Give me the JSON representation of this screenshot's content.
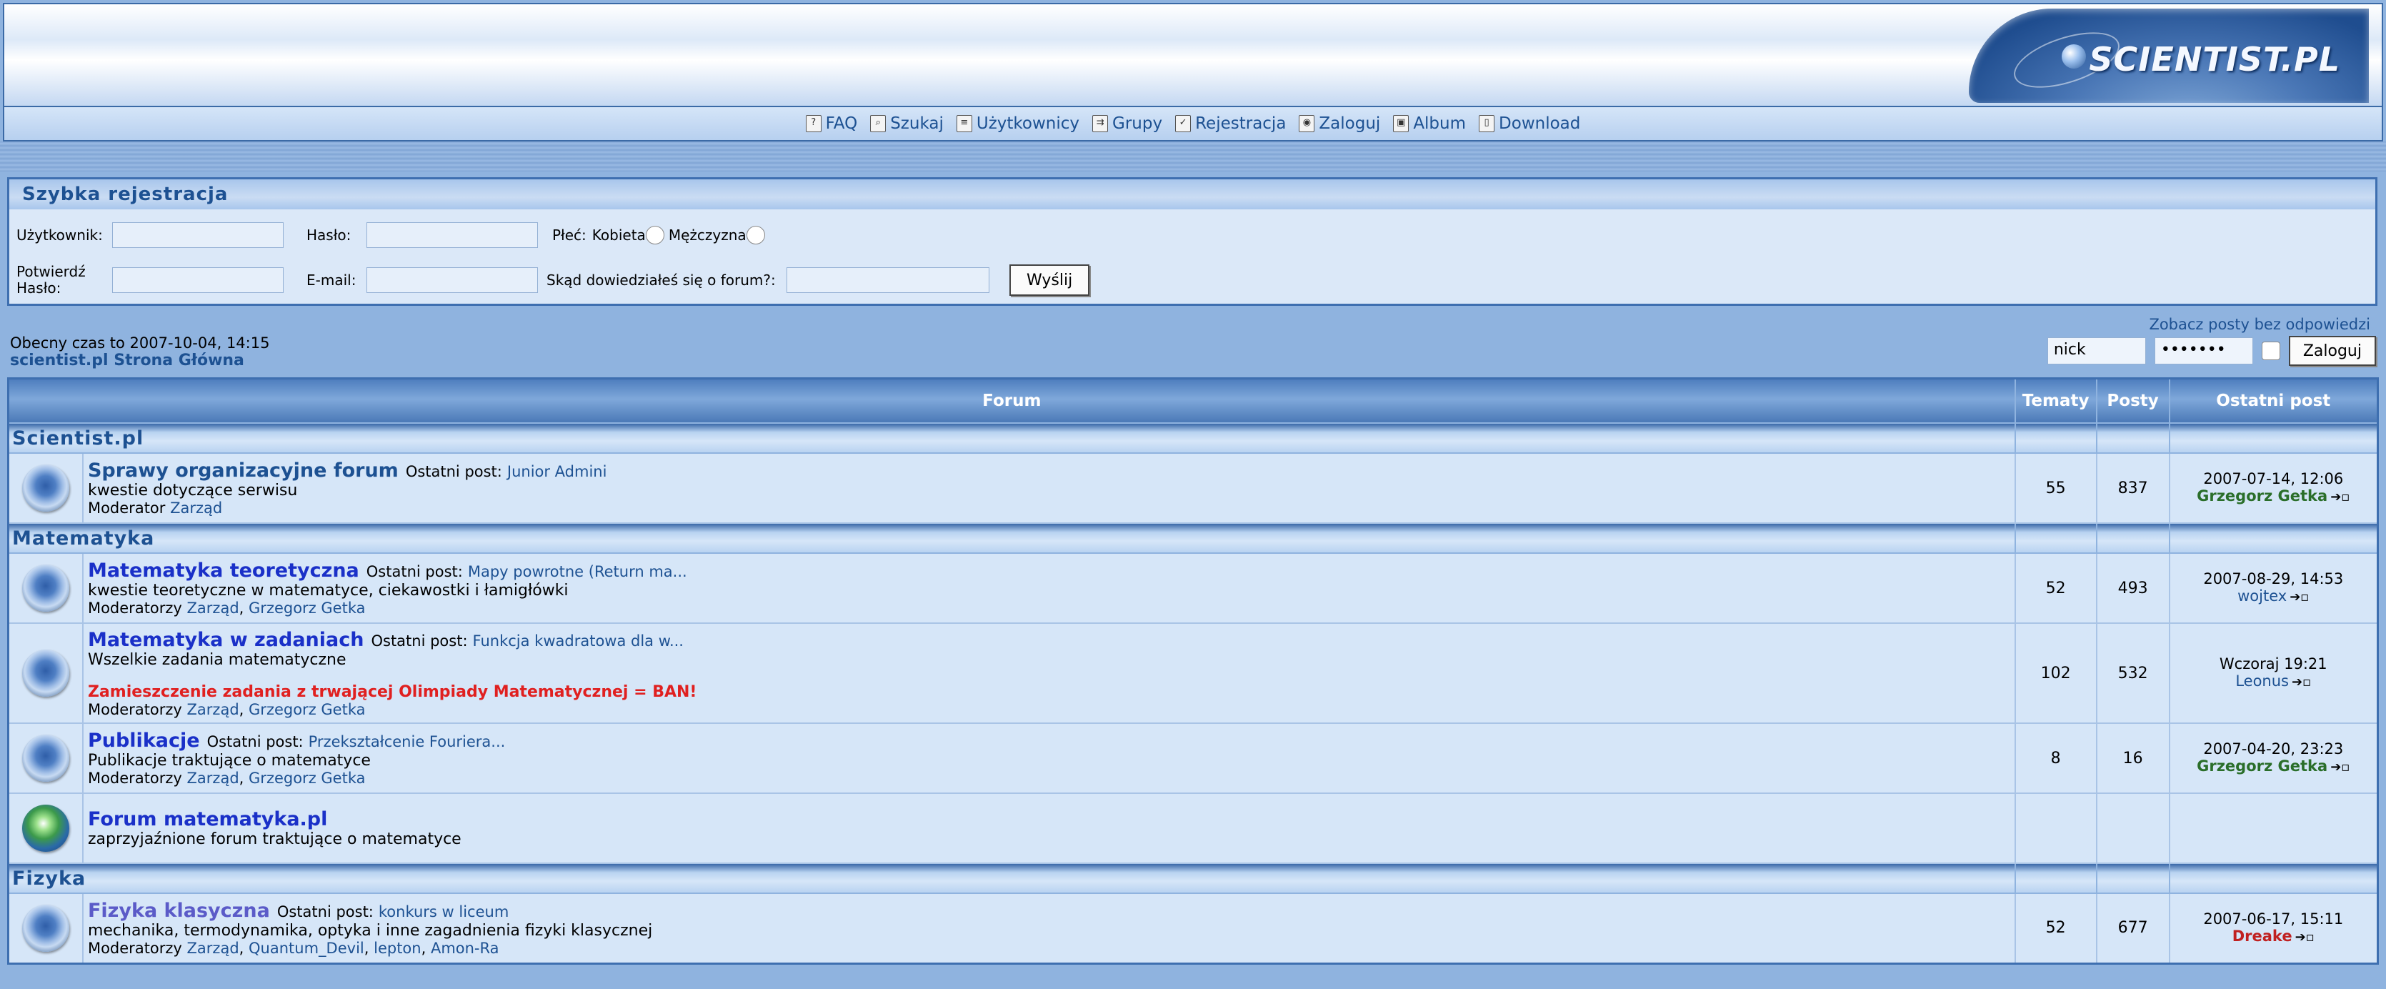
{
  "header": {
    "logo_text": "SCIENTIST.PL"
  },
  "nav": [
    {
      "label": "FAQ",
      "icon": "faq-icon",
      "glyph": "?"
    },
    {
      "label": "Szukaj",
      "icon": "search-icon",
      "glyph": "⌕"
    },
    {
      "label": "Użytkownicy",
      "icon": "members-icon",
      "glyph": "≡"
    },
    {
      "label": "Grupy",
      "icon": "groups-icon",
      "glyph": "⇉"
    },
    {
      "label": "Rejestracja",
      "icon": "register-icon",
      "glyph": "✓"
    },
    {
      "label": "Zaloguj",
      "icon": "login-icon",
      "glyph": "◉"
    },
    {
      "label": "Album",
      "icon": "album-icon",
      "glyph": "▣"
    },
    {
      "label": "Download",
      "icon": "download-icon",
      "glyph": "▯"
    }
  ],
  "quick_registration": {
    "title": "Szybka rejestracja",
    "username_label": "Użytkownik:",
    "password_label": "Hasło:",
    "gender_label": "Płeć:",
    "gender_female": "Kobieta",
    "gender_male": "Mężczyzna",
    "confirm_label_1": "Potwierdź",
    "confirm_label_2": "Hasło:",
    "email_label": "E-mail:",
    "source_label": "Skąd dowiedziałeś się o forum?:",
    "submit_label": "Wyślij"
  },
  "info": {
    "current_time": "Obecny czas to 2007-10-04, 14:15",
    "home_link": "scientist.pl Strona Główna",
    "unanswered_link": "Zobacz posty bez odpowiedzi"
  },
  "login": {
    "username_value": "nick",
    "password_value": "•••••••",
    "button_label": "Zaloguj"
  },
  "table_headers": {
    "forum": "Forum",
    "topics": "Tematy",
    "posts": "Posty",
    "last_post": "Ostatni post"
  },
  "categories": [
    {
      "name": "Scientist.pl",
      "forums": [
        {
          "title": "Sprawy organizacyjne forum",
          "title_style": "default",
          "last_post_label": "Ostatni post:",
          "last_post_link": "Junior Admini",
          "description": "kwestie dotyczące serwisu",
          "warning": "",
          "mod_label": "Moderator",
          "moderators": [
            "Zarząd"
          ],
          "topics": "55",
          "posts": "837",
          "last_date": "2007-07-14, 12:06",
          "last_user": "Grzegorz Getka",
          "last_user_style": "green",
          "icon": "forum-icon"
        }
      ]
    },
    {
      "name": "Matematyka",
      "forums": [
        {
          "title": "Matematyka teoretyczna",
          "title_style": "blue",
          "last_post_label": "Ostatni post:",
          "last_post_link": "Mapy powrotne (Return ma...",
          "description": "kwestie teoretyczne w matematyce, ciekawostki i łamigłówki",
          "warning": "",
          "mod_label": "Moderatorzy",
          "moderators": [
            "Zarząd",
            "Grzegorz Getka"
          ],
          "topics": "52",
          "posts": "493",
          "last_date": "2007-08-29, 14:53",
          "last_user": "wojtex",
          "last_user_style": "blue",
          "icon": "forum-icon"
        },
        {
          "title": "Matematyka w zadaniach",
          "title_style": "blue",
          "last_post_label": "Ostatni post:",
          "last_post_link": "Funkcja kwadratowa dla w...",
          "description": "Wszelkie zadania matematyczne",
          "warning": "Zamieszczenie zadania z trwającej Olimpiady Matematycznej = BAN!",
          "mod_label": "Moderatorzy",
          "moderators": [
            "Zarząd",
            "Grzegorz Getka"
          ],
          "topics": "102",
          "posts": "532",
          "last_date": "Wczoraj 19:21",
          "last_user": "Leonus",
          "last_user_style": "blue",
          "icon": "forum-icon"
        },
        {
          "title": "Publikacje",
          "title_style": "blue",
          "last_post_label": "Ostatni post:",
          "last_post_link": "Przekształcenie Fouriera...",
          "description": "Publikacje traktujące o matematyce",
          "warning": "",
          "mod_label": "Moderatorzy",
          "moderators": [
            "Zarząd",
            "Grzegorz Getka"
          ],
          "topics": "8",
          "posts": "16",
          "last_date": "2007-04-20, 23:23",
          "last_user": "Grzegorz Getka",
          "last_user_style": "green",
          "icon": "forum-icon"
        },
        {
          "title": "Forum matematyka.pl",
          "title_style": "blue",
          "last_post_label": "",
          "last_post_link": "",
          "description": "zaprzyjaźnione forum traktujące o matematyce",
          "warning": "",
          "mod_label": "",
          "moderators": [],
          "topics": "",
          "posts": "",
          "last_date": "",
          "last_user": "",
          "last_user_style": "blue",
          "icon": "globe-icon"
        }
      ]
    },
    {
      "name": "Fizyka",
      "forums": [
        {
          "title": "Fizyka klasyczna",
          "title_style": "purple",
          "last_post_label": "Ostatni post:",
          "last_post_link": "konkurs w liceum",
          "description": "mechanika, termodynamika, optyka i inne zagadnienia fizyki klasycznej",
          "warning": "",
          "mod_label": "Moderatorzy",
          "moderators": [
            "Zarząd",
            "Quantum_Devil",
            "lepton",
            "Amon-Ra"
          ],
          "topics": "52",
          "posts": "677",
          "last_date": "2007-06-17, 15:11",
          "last_user": "Dreake",
          "last_user_style": "red",
          "icon": "forum-icon"
        }
      ]
    }
  ],
  "colors": {
    "link": "#1d5192",
    "forum_title": "#1a30c8",
    "warning": "#e02020",
    "user_green": "#2a6e2a",
    "user_red": "#c02020"
  }
}
